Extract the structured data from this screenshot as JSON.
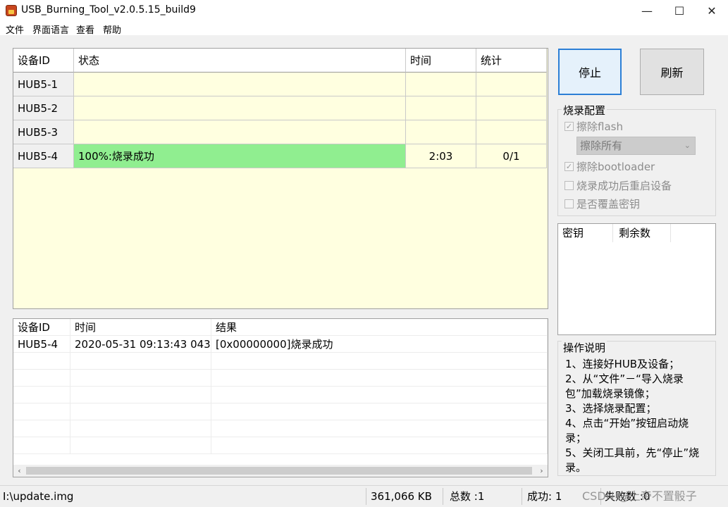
{
  "window": {
    "title": "USB_Burning_Tool_v2.0.5.15_build9",
    "minimize": "—",
    "maximize": "☐",
    "close": "✕"
  },
  "menu": [
    "文件",
    "界面语言",
    "查看",
    "帮助"
  ],
  "grid": {
    "headers": [
      "设备ID",
      "状态",
      "时间",
      "统计"
    ],
    "rows": [
      {
        "id": "HUB5-1",
        "status": "",
        "time": "",
        "stats": ""
      },
      {
        "id": "HUB5-2",
        "status": "",
        "time": "",
        "stats": ""
      },
      {
        "id": "HUB5-3",
        "status": "",
        "time": "",
        "stats": ""
      },
      {
        "id": "HUB5-4",
        "status": "100%:烧录成功",
        "time": "2:03",
        "stats": "0/1"
      }
    ],
    "colors": {
      "background": "#ffffe0",
      "success": "#90ee90"
    }
  },
  "buttons": {
    "stop": "停止",
    "refresh": "刷新"
  },
  "burn_config": {
    "title": "烧录配置",
    "erase_flash": {
      "label": "擦除flash",
      "checked": true
    },
    "erase_select": "擦除所有",
    "erase_bootloader": {
      "label": "擦除bootloader",
      "checked": true
    },
    "reboot_after": {
      "label": "烧录成功后重启设备",
      "checked": false
    },
    "overwrite_key": {
      "label": "是否覆盖密钥",
      "checked": false
    }
  },
  "key_list": {
    "headers": [
      "密钥",
      "剩余数"
    ]
  },
  "log": {
    "headers": [
      "设备ID",
      "时间",
      "结果"
    ],
    "rows": [
      {
        "id": "HUB5-4",
        "time": "2020-05-31 09:13:43 043",
        "result": "[0x00000000]烧录成功"
      }
    ],
    "scroll_left": "‹",
    "scroll_right": "›"
  },
  "instructions": {
    "title": "操作说明",
    "text": "1、连接好HUB及设备；\n2、从“文件”－“导入烧录包”加载烧录镜像；\n3、选择烧录配置；\n4、点击“开始”按钮启动烧录；\n5、关闭工具前，先“停止”烧录。"
  },
  "status": {
    "path": "I:\\update.img",
    "size": "361,066 KB",
    "total": "总数 :1",
    "success": "成功:  1",
    "fail": "失败数 :0"
  },
  "watermark": "CSDN @上帝不置骰子"
}
